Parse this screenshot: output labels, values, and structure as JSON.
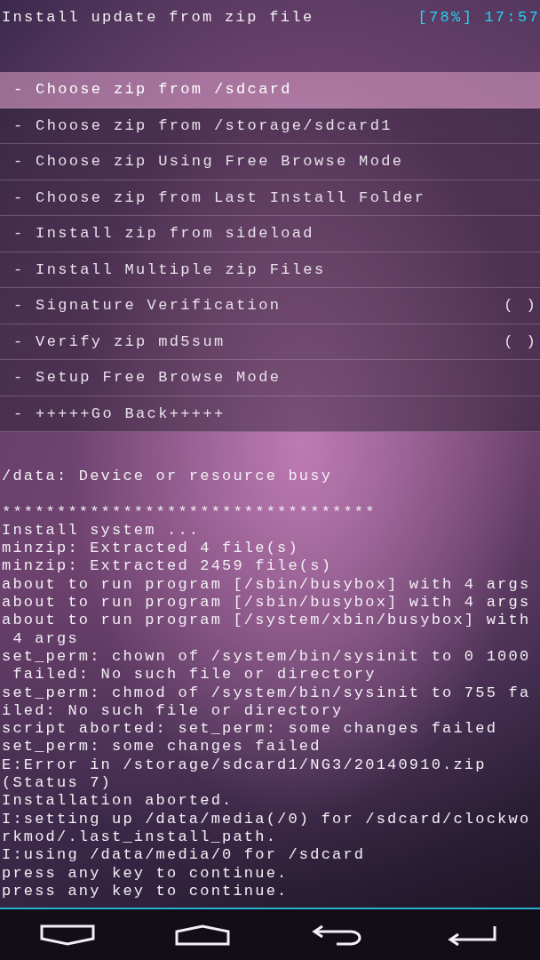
{
  "header": {
    "title": "Install update from zip file",
    "battery": "[78%]",
    "time": "17:57"
  },
  "menu": [
    {
      "label": "- Choose zip from /sdcard",
      "selected": true
    },
    {
      "label": "- Choose zip from /storage/sdcard1",
      "selected": false
    },
    {
      "label": "- Choose zip Using Free Browse Mode",
      "selected": false
    },
    {
      "label": "- Choose zip from Last Install Folder",
      "selected": false
    },
    {
      "label": "- Install zip from sideload",
      "selected": false
    },
    {
      "label": "- Install Multiple zip Files",
      "selected": false
    },
    {
      "label": "- Signature Verification",
      "selected": false,
      "toggle": "( )"
    },
    {
      "label": "- Verify zip md5sum",
      "selected": false,
      "toggle": "( )"
    },
    {
      "label": "- Setup Free Browse Mode",
      "selected": false
    },
    {
      "label": "- +++++Go Back+++++",
      "selected": false
    }
  ],
  "log_blocks": [
    {
      "lines": [
        "/data: Device or resource busy"
      ]
    },
    {
      "lines": [
        "**********************************",
        "Install system ...",
        "minzip: Extracted 4 file(s)",
        "minzip: Extracted 2459 file(s)",
        "about to run program [/sbin/busybox] with 4 args",
        "about to run program [/sbin/busybox] with 4 args",
        "about to run program [/system/xbin/busybox] with",
        " 4 args",
        "set_perm: chown of /system/bin/sysinit to 0 1000",
        " failed: No such file or directory",
        "set_perm: chmod of /system/bin/sysinit to 755 fa",
        "iled: No such file or directory",
        "script aborted: set_perm: some changes failed",
        "set_perm: some changes failed",
        "E:Error in /storage/sdcard1/NG3/20140910.zip",
        "(Status 7)",
        "Installation aborted.",
        "I:setting up /data/media(/0) for /sdcard/clockwo",
        "rkmod/.last_install_path.",
        "I:using /data/media/0 for /sdcard",
        "press any key to continue.",
        "press any key to continue."
      ]
    }
  ],
  "nav": [
    {
      "kind": "down"
    },
    {
      "kind": "home"
    },
    {
      "kind": "back"
    },
    {
      "kind": "enter"
    }
  ]
}
